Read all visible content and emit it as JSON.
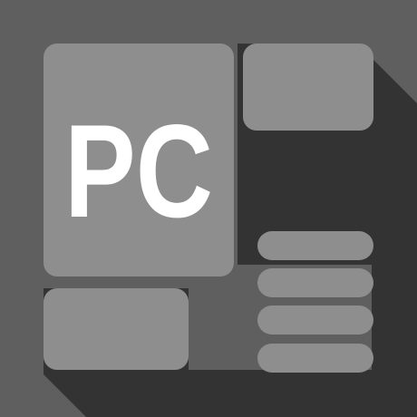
{
  "app_icon": {
    "label": "PC",
    "colors": {
      "background": "#5f5f5f",
      "shadow": "#333333",
      "tile": "#8e8e8e",
      "text": "#ffffff"
    }
  }
}
